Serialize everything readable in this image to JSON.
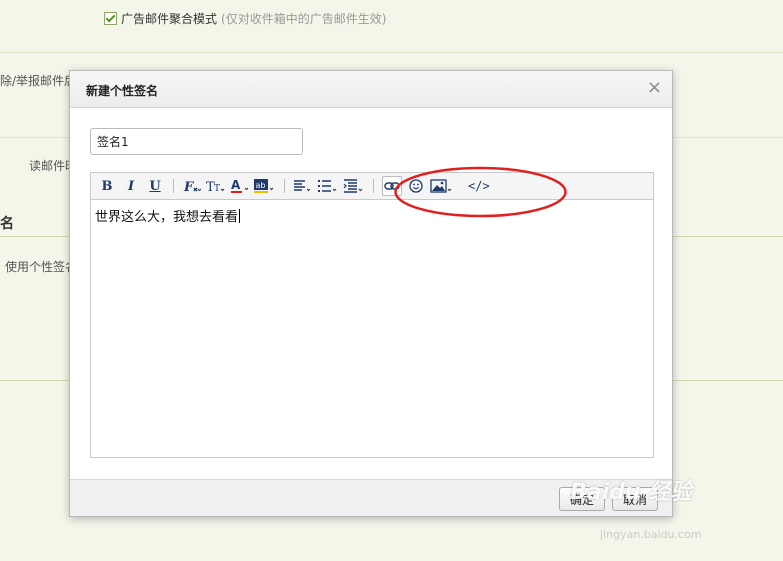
{
  "background": {
    "ad_option_label": "广告邮件聚合模式",
    "ad_option_note": "(仅对收件箱中的广告邮件生效)",
    "row2_label": "除/举报邮件后",
    "row3_label": "读邮件时",
    "section_heading": "名",
    "row4_label": "使用个性签名"
  },
  "dialog": {
    "title": "新建个性签名",
    "close_symbol": "×",
    "name_value": "签名1",
    "toolbar": {
      "bold": "B",
      "italic": "I",
      "underline": "U",
      "html_label": "</>"
    },
    "editor_text": "世界这么大，我想去看看",
    "ok_label": "确定",
    "cancel_label": "取消"
  },
  "watermark": {
    "main": "Baidu 经验",
    "sub": "jingyan.baidu.com"
  },
  "colors": {
    "page_bg": "#f3f6e9",
    "annotation_red": "#e02020",
    "toolbar_icon": "#1f3a6b"
  }
}
